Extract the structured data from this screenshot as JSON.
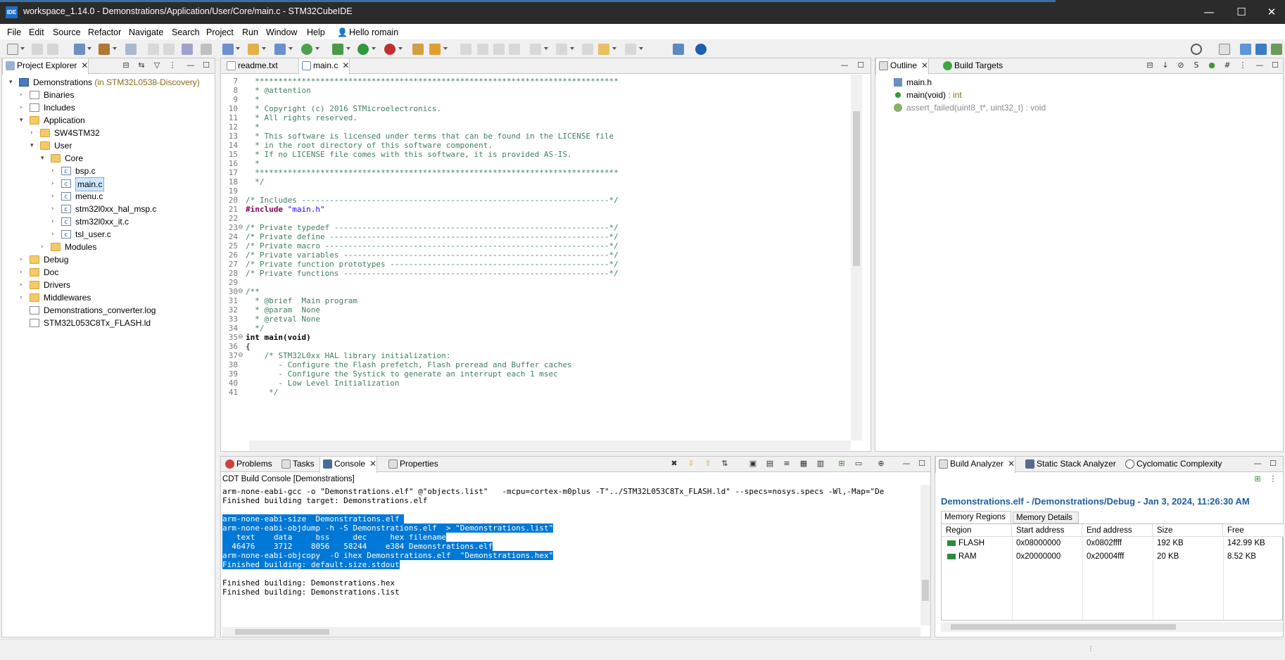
{
  "window": {
    "title": "workspace_1.14.0 - Demonstrations/Application/User/Core/main.c - STM32CubeIDE",
    "logo": "IDE",
    "minimize": "—",
    "maximize": "☐",
    "close": "✕"
  },
  "menu": [
    "File",
    "Edit",
    "Source",
    "Refactor",
    "Navigate",
    "Search",
    "Project",
    "Run",
    "Window",
    "Help"
  ],
  "user": "Hello romain",
  "project_explorer": {
    "tab_label": "Project Explorer",
    "items": [
      {
        "label": "Demonstrations",
        "suffix": " (in STM32L0538-Discovery)"
      },
      {
        "label": "Binaries"
      },
      {
        "label": "Includes"
      },
      {
        "label": "Application"
      },
      {
        "label": "SW4STM32"
      },
      {
        "label": "User"
      },
      {
        "label": "Core"
      },
      {
        "label": "bsp.c"
      },
      {
        "label": "main.c"
      },
      {
        "label": "menu.c"
      },
      {
        "label": "stm32l0xx_hal_msp.c"
      },
      {
        "label": "stm32l0xx_it.c"
      },
      {
        "label": "tsl_user.c"
      },
      {
        "label": "Modules"
      },
      {
        "label": "Debug"
      },
      {
        "label": "Doc"
      },
      {
        "label": "Drivers"
      },
      {
        "label": "Middlewares"
      },
      {
        "label": "Demonstrations_converter.log"
      },
      {
        "label": "STM32L053C8Tx_FLASH.ld"
      }
    ]
  },
  "editor": {
    "tabs": [
      {
        "label": "readme.txt"
      },
      {
        "label": "main.c"
      }
    ],
    "lines": [
      {
        "n": "7",
        "t": "  ******************************************************************************"
      },
      {
        "n": "8",
        "t": "  * @attention"
      },
      {
        "n": "9",
        "t": "  *"
      },
      {
        "n": "10",
        "t": "  * Copyright (c) 2016 STMicroelectronics."
      },
      {
        "n": "11",
        "t": "  * All rights reserved."
      },
      {
        "n": "12",
        "t": "  *"
      },
      {
        "n": "13",
        "t": "  * This software is licensed under terms that can be found in the LICENSE file"
      },
      {
        "n": "14",
        "t": "  * in the root directory of this software component."
      },
      {
        "n": "15",
        "t": "  * If no LICENSE file comes with this software, it is provided AS-IS."
      },
      {
        "n": "16",
        "t": "  *"
      },
      {
        "n": "17",
        "t": "  ******************************************************************************"
      },
      {
        "n": "18",
        "t": "  */"
      },
      {
        "n": "19",
        "t": ""
      },
      {
        "n": "20",
        "t": "/* Includes ------------------------------------------------------------------*/"
      },
      {
        "n": "21",
        "t": "#include \"main.h\""
      },
      {
        "n": "22",
        "t": ""
      },
      {
        "n": "23",
        "t": "/* Private typedef -----------------------------------------------------------*/"
      },
      {
        "n": "24",
        "t": "/* Private define ------------------------------------------------------------*/"
      },
      {
        "n": "25",
        "t": "/* Private macro -------------------------------------------------------------*/"
      },
      {
        "n": "26",
        "t": "/* Private variables ---------------------------------------------------------*/"
      },
      {
        "n": "27",
        "t": "/* Private function prototypes -----------------------------------------------*/"
      },
      {
        "n": "28",
        "t": "/* Private functions ---------------------------------------------------------*/"
      },
      {
        "n": "29",
        "t": ""
      },
      {
        "n": "30",
        "t": "/**"
      },
      {
        "n": "31",
        "t": "  * @brief  Main program"
      },
      {
        "n": "32",
        "t": "  * @param  None"
      },
      {
        "n": "33",
        "t": "  * @retval None"
      },
      {
        "n": "34",
        "t": "  */"
      },
      {
        "n": "35",
        "t": "int main(void)"
      },
      {
        "n": "36",
        "t": "{"
      },
      {
        "n": "37",
        "t": "    /* STM32L0xx HAL library initialization:"
      },
      {
        "n": "38",
        "t": "       - Configure the Flash prefetch, Flash preread and Buffer caches"
      },
      {
        "n": "39",
        "t": "       - Configure the Systick to generate an interrupt each 1 msec"
      },
      {
        "n": "40",
        "t": "       - Low Level Initialization"
      },
      {
        "n": "41",
        "t": "     */"
      }
    ]
  },
  "outline": {
    "tabs": [
      {
        "label": "Outline"
      },
      {
        "label": "Build Targets"
      }
    ],
    "items": [
      {
        "label": "main.h",
        "suffix": ""
      },
      {
        "label": "main(void)",
        "suffix": " : int"
      },
      {
        "label": "assert_failed(uint8_t*, uint32_t)",
        "suffix": " : void"
      }
    ]
  },
  "console": {
    "tabs": [
      {
        "label": "Problems"
      },
      {
        "label": "Tasks"
      },
      {
        "label": "Console"
      },
      {
        "label": "Properties"
      }
    ],
    "title": "CDT Build Console [Demonstrations]",
    "lines": [
      {
        "t": "arm-none-eabi-gcc -o \"Demonstrations.elf\" @\"objects.list\"   -mcpu=cortex-m0plus -T\"../STM32L053C8Tx_FLASH.ld\" --specs=nosys.specs -Wl,-Map=\"De",
        "sel": false
      },
      {
        "t": "Finished building target: Demonstrations.elf",
        "sel": false
      },
      {
        "t": " ",
        "sel": false
      },
      {
        "t": "arm-none-eabi-size  Demonstrations.elf ",
        "sel": true
      },
      {
        "t": "arm-none-eabi-objdump -h -S Demonstrations.elf  > \"Demonstrations.list\"",
        "sel": true
      },
      {
        "t": "   text\t   data\t    bss\t    dec\t    hex\tfilename",
        "sel": true
      },
      {
        "t": "  46476\t   3712\t   8056\t  58244\t   e384\tDemonstrations.elf",
        "sel": true
      },
      {
        "t": "arm-none-eabi-objcopy  -O ihex Demonstrations.elf  \"Demonstrations.hex\"",
        "sel": true
      },
      {
        "t": "Finished building: default.size.stdout",
        "sel": true
      },
      {
        "t": " ",
        "sel": false
      },
      {
        "t": "Finished building: Demonstrations.hex",
        "sel": false
      },
      {
        "t": "Finished building: Demonstrations.list",
        "sel": false
      }
    ]
  },
  "build_analyzer": {
    "tabs": [
      {
        "label": "Build Analyzer"
      },
      {
        "label": "Static Stack Analyzer"
      },
      {
        "label": "Cyclomatic Complexity"
      }
    ],
    "heading": "Demonstrations.elf - /Demonstrations/Debug - Jan 3, 2024, 11:26:30 AM",
    "subtabs": [
      "Memory Regions",
      "Memory Details"
    ],
    "columns": [
      "Region",
      "Start address",
      "End address",
      "Size",
      "Free"
    ],
    "rows": [
      {
        "region": "FLASH",
        "start": "0x08000000",
        "end": "0x0802ffff",
        "size": "192 KB",
        "free": "142.99 KB"
      },
      {
        "region": "RAM",
        "start": "0x20000000",
        "end": "0x20004fff",
        "size": "20 KB",
        "free": "8.52 KB"
      }
    ]
  }
}
